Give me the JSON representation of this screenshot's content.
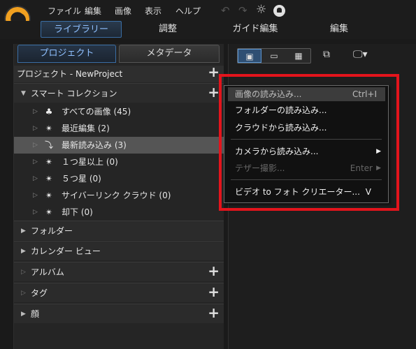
{
  "menu": {
    "items": [
      "ファイル",
      "編集",
      "画像",
      "表示",
      "ヘルプ"
    ],
    "undo_icon": "undo-icon",
    "redo_icon": "redo-icon",
    "settings_icon": "gear-icon",
    "notify_icon": "bell-icon"
  },
  "main_tabs": [
    "ライブラリー",
    "調整",
    "ガイド編集",
    "編集"
  ],
  "panel_tabs": {
    "project": "プロジェクト",
    "metadata": "メタデータ"
  },
  "project": {
    "title": "プロジェクト - NewProject"
  },
  "smart_collection": {
    "label": "スマート コレクション",
    "items": [
      {
        "label": "すべての画像 (45)",
        "icon": "hierarchy-icon"
      },
      {
        "label": "最近編集 (2)",
        "icon": "magic-wand-icon"
      },
      {
        "label": "最新読み込み (3)",
        "icon": "import-arrow-icon",
        "selected": true
      },
      {
        "label": "１つ星以上 (0)",
        "icon": "magic-wand-icon"
      },
      {
        "label": "５つ星 (0)",
        "icon": "magic-wand-icon"
      },
      {
        "label": "サイバーリンク クラウド (0)",
        "icon": "magic-wand-icon"
      },
      {
        "label": "却下 (0)",
        "icon": "magic-wand-icon"
      }
    ]
  },
  "sections": {
    "folder": "フォルダー",
    "calendar": "カレンダー ビュー",
    "album": "アルバム",
    "tag": "タグ",
    "face": "顔"
  },
  "import_menu": {
    "items": [
      {
        "label": "画像の読み込み...",
        "shortcut": "Ctrl+I"
      },
      {
        "label": "フォルダーの読み込み..."
      },
      {
        "label": "クラウドから読み込み..."
      },
      {
        "label": "カメラから読み込み..."
      },
      {
        "label": "テザー撮影...",
        "shortcut": "Enter"
      },
      {
        "label": "ビデオ to フォト クリエーター...",
        "shortcut": "V"
      }
    ]
  },
  "colors": {
    "accent": "#5c95d0",
    "highlight_frame": "#e3141c",
    "selected_row": "#555555"
  }
}
